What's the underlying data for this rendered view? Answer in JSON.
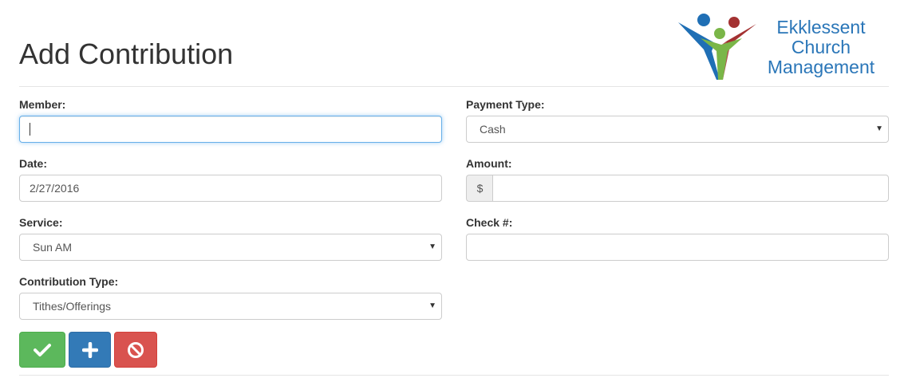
{
  "page": {
    "title": "Add Contribution"
  },
  "logo": {
    "line1": "Ekklessent",
    "line2": "Church",
    "line3": "Management"
  },
  "form": {
    "member": {
      "label": "Member:",
      "value": ""
    },
    "date": {
      "label": "Date:",
      "value": "2/27/2016"
    },
    "service": {
      "label": "Service:",
      "selected": "Sun AM"
    },
    "contribution_type": {
      "label": "Contribution Type:",
      "selected": "Tithes/Offerings"
    },
    "payment_type": {
      "label": "Payment Type:",
      "selected": "Cash"
    },
    "amount": {
      "label": "Amount:",
      "addon": "$",
      "value": ""
    },
    "check_number": {
      "label": "Check #:",
      "value": ""
    }
  },
  "icons": {
    "save": "check-icon",
    "add": "plus-icon",
    "cancel": "ban-icon",
    "dropdown": "caret-down-icon"
  },
  "colors": {
    "save_button": "#5cb85c",
    "add_button": "#337ab7",
    "cancel_button": "#d9534f",
    "logo_text": "#2a76b8",
    "focus_border": "#66afe9"
  }
}
